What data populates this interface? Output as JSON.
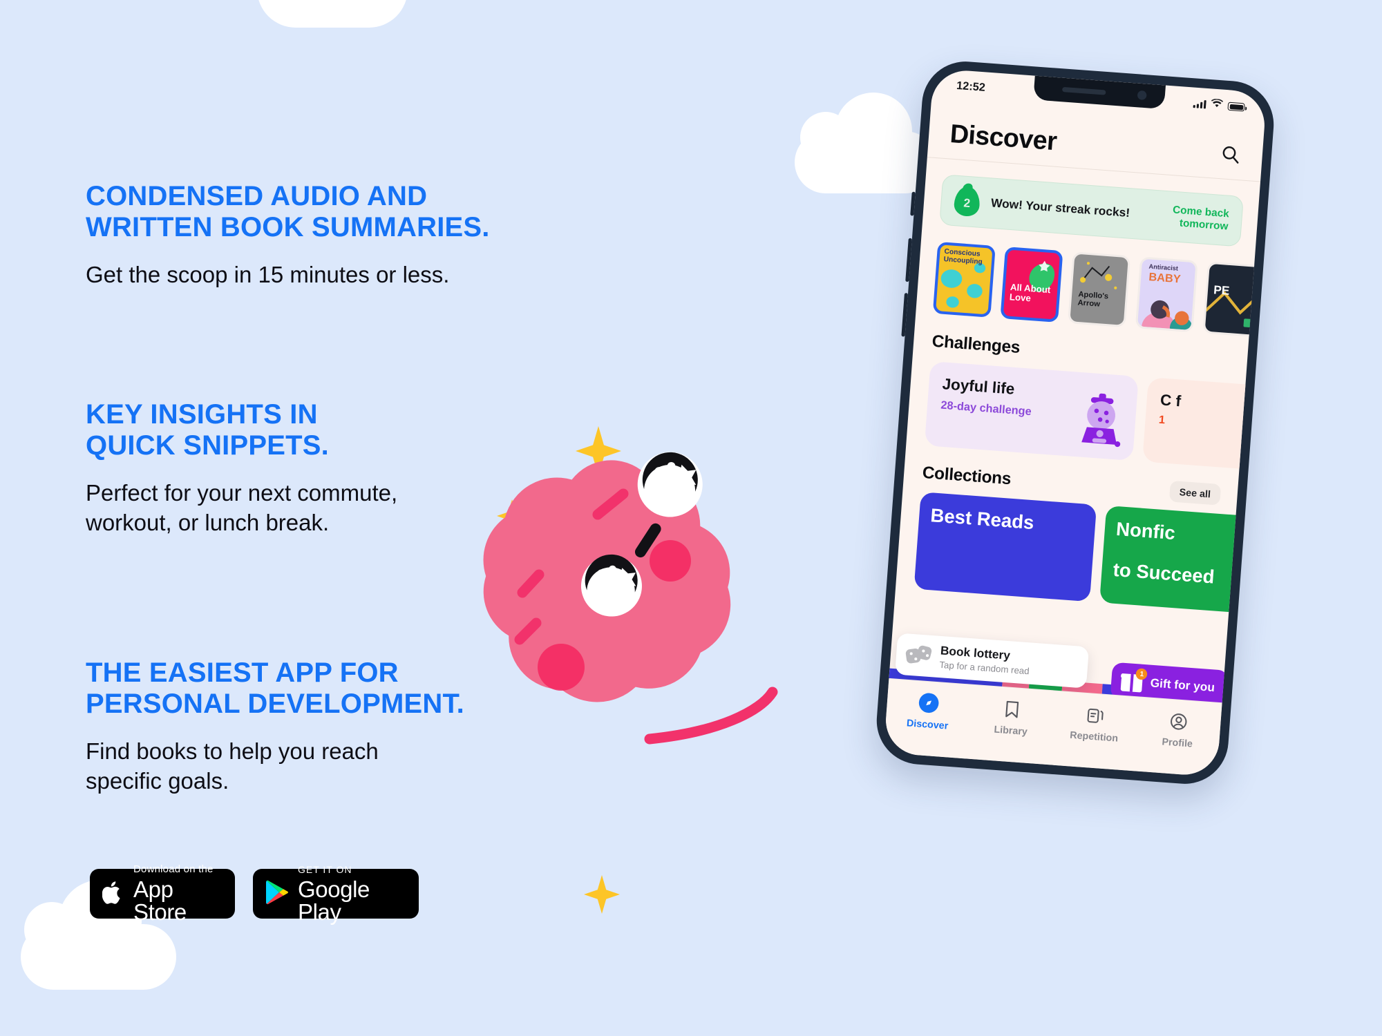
{
  "background_color": "#dce8fb",
  "accent_color": "#1572f5",
  "marketing": {
    "blocks": [
      {
        "heading_line1": "CONDENSED AUDIO AND",
        "heading_line2": "WRITTEN BOOK SUMMARIES.",
        "sub_line1": "Get the scoop in 15 minutes or less.",
        "sub_line2": ""
      },
      {
        "heading_line1": "KEY INSIGHTS IN",
        "heading_line2": "QUICK SNIPPETS.",
        "sub_line1": "Perfect for your next commute,",
        "sub_line2": "workout, or lunch break."
      },
      {
        "heading_line1": "THE EASIEST APP FOR",
        "heading_line2": "PERSONAL DEVELOPMENT.",
        "sub_line1": "Find books to help you reach",
        "sub_line2": "specific goals."
      }
    ]
  },
  "store_badges": {
    "appstore": {
      "small": "Download on the",
      "big": "App Store",
      "icon": "apple-icon"
    },
    "googleplay": {
      "small": "GET IT ON",
      "big": "Google Play",
      "icon": "google-play-icon"
    }
  },
  "phone": {
    "status_bar": {
      "time": "12:52",
      "signal_icon": "cellular-signal-icon",
      "wifi_icon": "wifi-icon",
      "battery_icon": "battery-full-icon"
    },
    "header": {
      "title": "Discover",
      "search_icon": "search-icon"
    },
    "streak": {
      "count": "2",
      "flame_icon": "flame-icon",
      "message": "Wow! Your streak rocks!",
      "cta_line1": "Come back",
      "cta_line2": "tomorrow",
      "color": "#11b65a"
    },
    "books": [
      {
        "title": "Conscious Uncoupling",
        "color": "#f5c328"
      },
      {
        "title": "All About Love",
        "color": "#f2125d"
      },
      {
        "title": "Apollo's Arrow",
        "color": "#8e8e8e"
      },
      {
        "title": "Antiracist",
        "title2": "BABY",
        "color": "#ded6f8"
      },
      {
        "title": "PE",
        "color": "#1d2634"
      }
    ],
    "challenges": {
      "section_title": "Challenges",
      "cards": [
        {
          "title": "Joyful life",
          "subtitle": "28-day challenge",
          "icon": "gumball-machine-icon"
        },
        {
          "title": "C f",
          "subtitle": "1",
          "icon": "challenge-icon"
        }
      ]
    },
    "collections": {
      "section_title": "Collections",
      "see_all_label": "See all",
      "cards": [
        {
          "title": "Best Reads",
          "color": "#3b3bdb"
        },
        {
          "title": "Nonfic",
          "subtitle": "to Succeed",
          "color": "#16a74a"
        }
      ]
    },
    "book_lottery": {
      "title": "Book lottery",
      "subtitle": "Tap for a random read",
      "icon": "dice-icon"
    },
    "gift": {
      "label": "Gift for you",
      "badge": "1",
      "icon": "gift-icon"
    },
    "tabs": [
      {
        "label": "Discover",
        "icon": "compass-icon",
        "active": true
      },
      {
        "label": "Library",
        "icon": "bookmark-icon",
        "active": false
      },
      {
        "label": "Repetition",
        "icon": "cards-icon",
        "active": false
      },
      {
        "label": "Profile",
        "icon": "person-circle-icon",
        "active": false
      }
    ]
  },
  "decor": {
    "mascot": "pink-brain-mascot",
    "clouds": [
      "cloud-top",
      "cloud-right-upper",
      "cloud-mid",
      "cloud-bottom-left"
    ],
    "sparkles": [
      "sparkle-1",
      "sparkle-2",
      "sparkle-3"
    ]
  }
}
